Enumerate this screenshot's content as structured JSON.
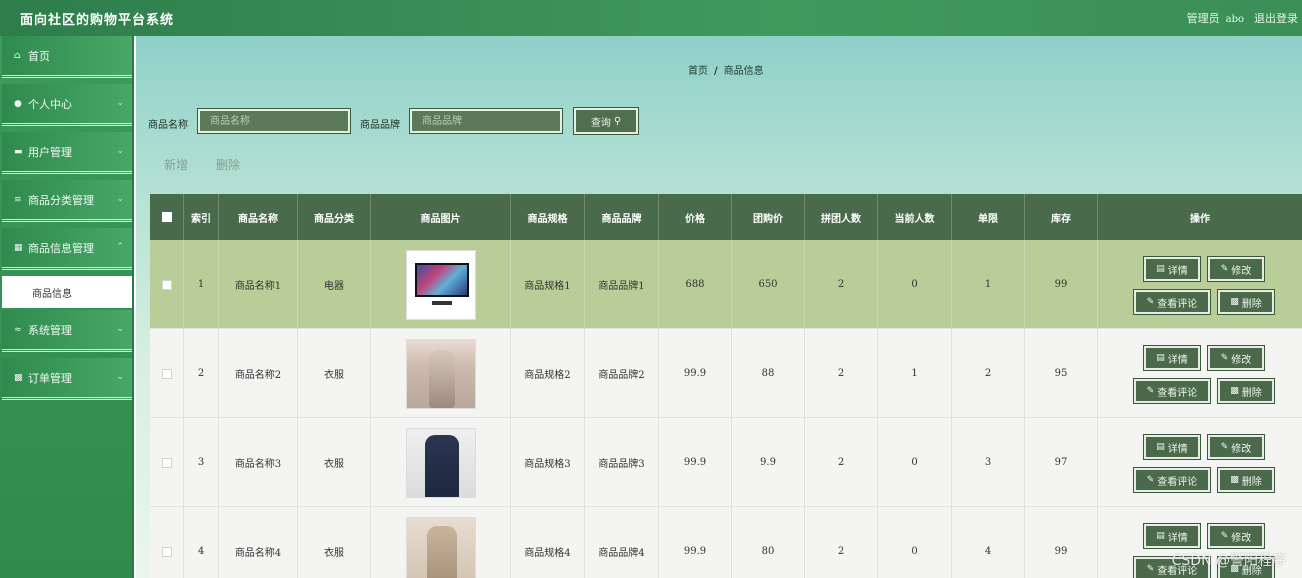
{
  "header": {
    "app_title": "面向社区的购物平台系统",
    "admin_label": "管理员",
    "admin_name": "abo",
    "logout_label": "退出登录"
  },
  "sidebar": {
    "items": [
      {
        "label": "首页",
        "icon": "home-icon"
      },
      {
        "label": "个人中心",
        "icon": "user-icon"
      },
      {
        "label": "用户管理",
        "icon": "monitor-icon"
      },
      {
        "label": "商品分类管理",
        "icon": "list-icon"
      },
      {
        "label": "商品信息管理",
        "icon": "grid-icon"
      },
      {
        "label": "系统管理",
        "icon": "sliders-icon"
      },
      {
        "label": "订单管理",
        "icon": "apps-icon"
      }
    ],
    "active_sub": "商品信息"
  },
  "breadcrumb": {
    "home": "首页",
    "separator": "/",
    "current": "商品信息"
  },
  "search": {
    "name_label": "商品名称",
    "name_placeholder": "商品名称",
    "brand_label": "商品品牌",
    "brand_placeholder": "商品品牌",
    "query_label": "查询"
  },
  "toolbar": {
    "add_label": "新增",
    "delete_label": "删除"
  },
  "table": {
    "headers": [
      "索引",
      "商品名称",
      "商品分类",
      "商品图片",
      "商品规格",
      "商品品牌",
      "价格",
      "团购价",
      "拼团人数",
      "当前人数",
      "单限",
      "库存",
      "操作"
    ],
    "rows": [
      {
        "index": "1",
        "name": "商品名称1",
        "category": "电器",
        "image": "tv",
        "spec": "商品规格1",
        "brand": "商品品牌1",
        "price": "688",
        "group_price": "650",
        "group_size": "2",
        "current": "0",
        "limit": "1",
        "stock": "99"
      },
      {
        "index": "2",
        "name": "商品名称2",
        "category": "衣服",
        "image": "cloth1",
        "spec": "商品规格2",
        "brand": "商品品牌2",
        "price": "99.9",
        "group_price": "88",
        "group_size": "2",
        "current": "1",
        "limit": "2",
        "stock": "95"
      },
      {
        "index": "3",
        "name": "商品名称3",
        "category": "衣服",
        "image": "cloth2",
        "spec": "商品规格3",
        "brand": "商品品牌3",
        "price": "99.9",
        "group_price": "9.9",
        "group_size": "2",
        "current": "0",
        "limit": "3",
        "stock": "97"
      },
      {
        "index": "4",
        "name": "商品名称4",
        "category": "衣服",
        "image": "cloth3",
        "spec": "商品规格4",
        "brand": "商品品牌4",
        "price": "99.9",
        "group_price": "80",
        "group_size": "2",
        "current": "0",
        "limit": "4",
        "stock": "99"
      }
    ],
    "actions": {
      "detail": "详情",
      "edit": "修改",
      "review": "查看评论",
      "delete": "删除"
    }
  },
  "watermark": "CSDN @警阳程序"
}
